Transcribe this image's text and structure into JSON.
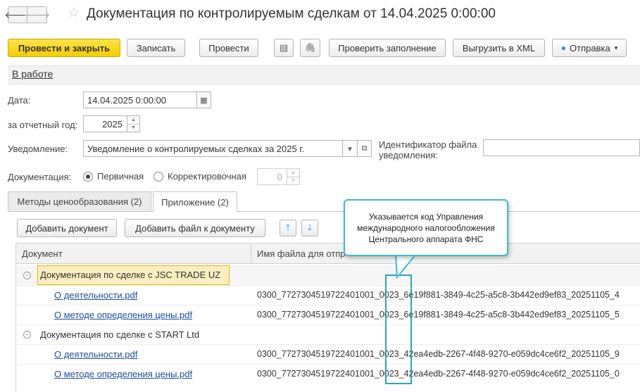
{
  "window": {
    "title": "Документация по контролируемым сделкам от 14.04.2025 0:00:00",
    "back_glyph": "🡐",
    "forward_glyph": "🡒",
    "star_glyph": "☆"
  },
  "toolbar": {
    "post_close": "Провести и закрыть",
    "save": "Записать",
    "post": "Провести",
    "check_fill": "Проверить заполнение",
    "export_xml": "Выгрузить в XML",
    "send": "Отправка",
    "list_icon_glyph": "▤",
    "clip_icon_glyph": "🖇",
    "send_icon_glyph": "●",
    "caret_glyph": "▾"
  },
  "status": {
    "label": "В работе"
  },
  "form": {
    "date_label": "Дата:",
    "date_value": "14.04.2025  0:00:00",
    "year_label": "за отчетный год:",
    "year_value": "2025",
    "notice_label": "Уведомление:",
    "notice_value": "Уведомление о контролируемых сделках за 2025 г.",
    "file_id_label_1": "Идентификатор файла",
    "file_id_label_2": "уведомления:",
    "file_id_value": "",
    "doc_label": "Документация:",
    "radio_primary": "Первичная",
    "radio_corrective": "Корректировочная",
    "corr_number": "0",
    "calendar_glyph": "▦",
    "dropdown_glyph": "▾",
    "open_glyph": "⧉",
    "spin_up": "▲",
    "spin_down": "▼"
  },
  "tabs": [
    {
      "label": "Методы ценообразования (2)"
    },
    {
      "label": "Приложение (2)"
    }
  ],
  "attach_toolbar": {
    "add_doc": "Добавить документ",
    "add_file": "Добавить файл к документу",
    "up_glyph": "🡑",
    "down_glyph": "🡓"
  },
  "table": {
    "columns": [
      "Документ",
      "Имя файла для отпр"
    ],
    "collapse_glyph": "−",
    "groups": [
      {
        "name": "Документация по сделке с JSC TRADE UZ",
        "rows": [
          {
            "doc": "О деятельности.pdf",
            "file": "0300_7727304519722401001_0023_6e19f881-3849-4c25-a5c8-3b442ed9ef83_20251105_4"
          },
          {
            "doc": "О методе определения цены.pdf",
            "file": "0300_7727304519722401001_0023_6e19f881-3849-4c25-a5c8-3b442ed9ef83_20251105_5"
          }
        ]
      },
      {
        "name": "Документация по сделке с START Ltd",
        "rows": [
          {
            "doc": "О деятельности.pdf",
            "file": "0300_7727304519722401001_0023_42ea4edb-2267-4f48-9270-e059dc4ce6f2_20251105_9"
          },
          {
            "doc": "О методе определения цены.pdf",
            "file": "0300_7727304519722401001_0023_42ea4edb-2267-4f48-9270-e059dc4ce6f2_20251105_0"
          }
        ]
      }
    ]
  },
  "callout": {
    "line1": "Указывается код Управления",
    "line2": "международного налогообложения",
    "line3": "Центрального аппарата ФНС"
  },
  "colors": {
    "primary_button": "#f5cd00",
    "link": "#1c4ea0",
    "selected_row": "#fbeec0",
    "callout_border": "#3cbcd0"
  }
}
